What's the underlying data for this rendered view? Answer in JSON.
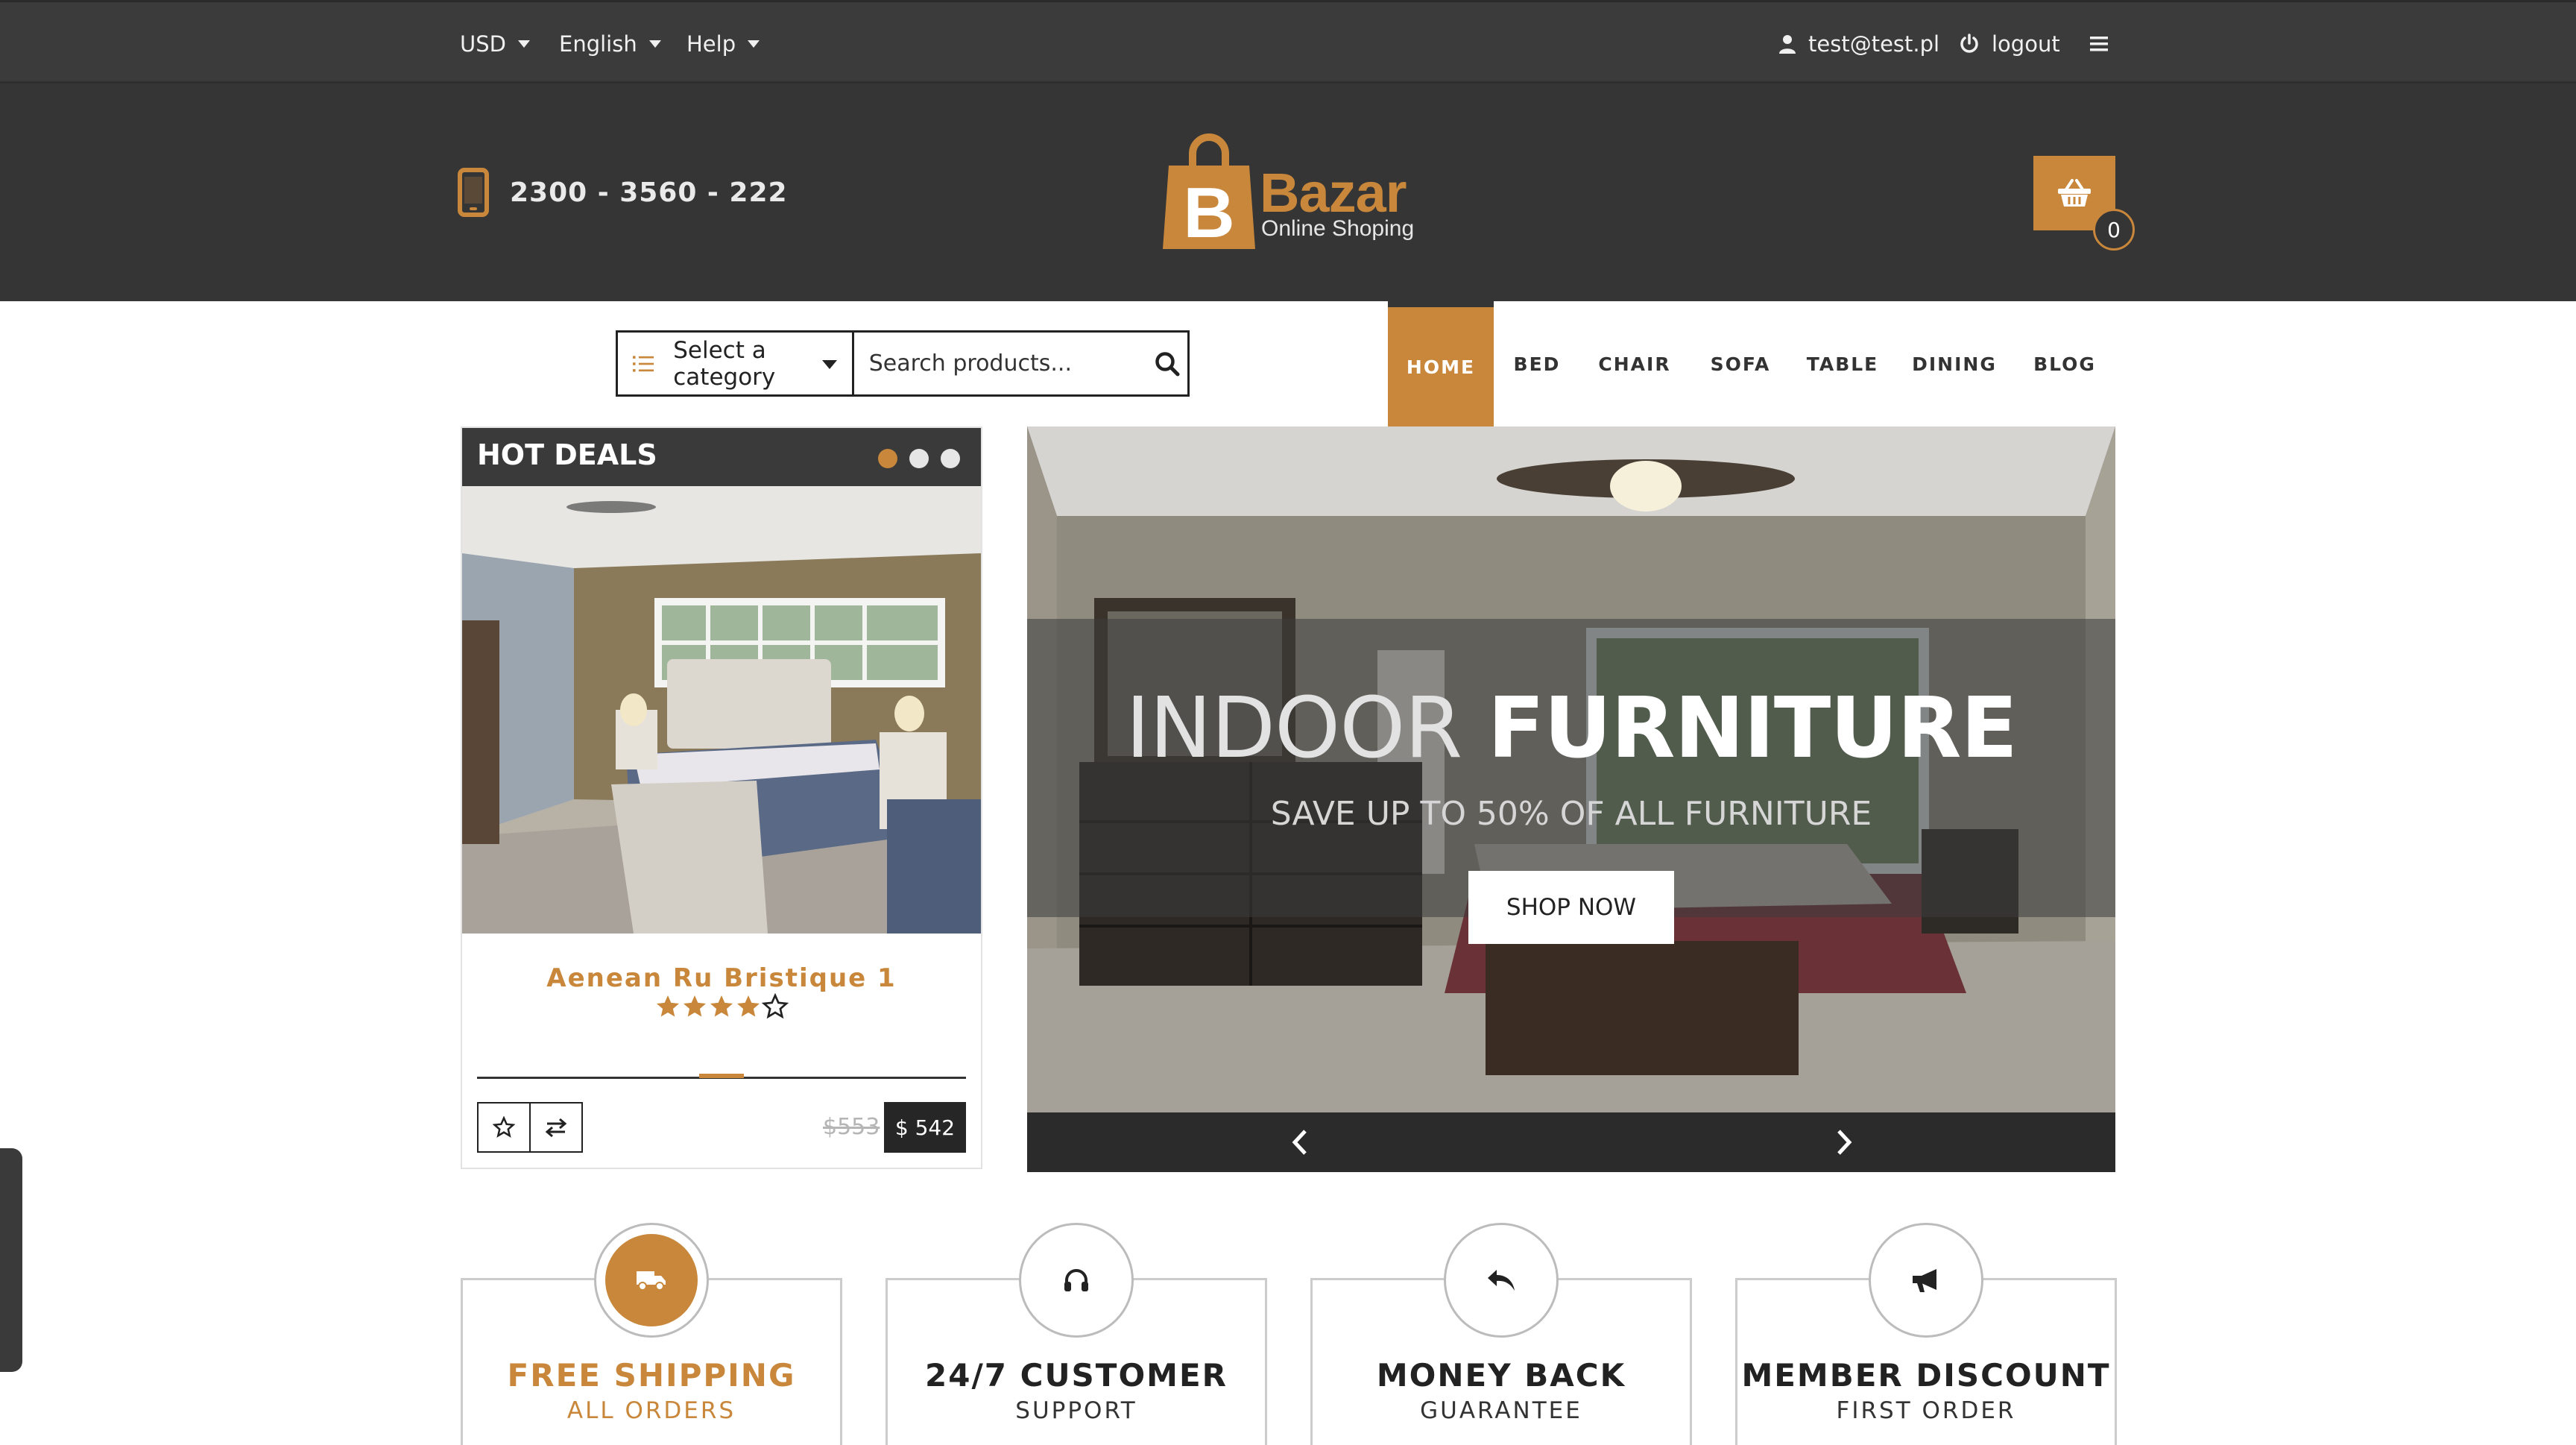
{
  "topbar": {
    "currency": "USD",
    "language": "English",
    "help": "Help",
    "user_email": "test@test.pl",
    "logout": "logout"
  },
  "header": {
    "phone": "2300 - 3560 - 222",
    "logo_letter": "B",
    "logo_name": "Bazar",
    "logo_tagline": "Online Shoping",
    "cart_count": "0"
  },
  "search": {
    "category_label": "Select a category",
    "placeholder": "Search products..."
  },
  "nav": {
    "items": [
      {
        "label": "HOME",
        "active": true
      },
      {
        "label": "BED"
      },
      {
        "label": "CHAIR"
      },
      {
        "label": "SOFA"
      },
      {
        "label": "TABLE"
      },
      {
        "label": "DINING"
      },
      {
        "label": "BLOG"
      }
    ]
  },
  "hot_deals": {
    "title": "HOT DEALS",
    "product_name": "Aenean Ru Bristique 1",
    "rating_stars": 4,
    "rating_max": 5,
    "old_price": "$553",
    "price": "$ 542"
  },
  "hero": {
    "title_light": "INDOOR ",
    "title_bold": "FURNITURE",
    "subtitle": "SAVE UP TO 50% OF ALL FURNITURE",
    "button": "SHOP NOW"
  },
  "features": [
    {
      "title": "FREE SHIPPING",
      "subtitle": "ALL ORDERS",
      "icon": "truck-icon"
    },
    {
      "title": "24/7 CUSTOMER",
      "subtitle": "SUPPORT",
      "icon": "headphones-icon"
    },
    {
      "title": "MONEY BACK",
      "subtitle": "GUARANTEE",
      "icon": "reply-icon"
    },
    {
      "title": "MEMBER DISCOUNT",
      "subtitle": "FIRST ORDER",
      "icon": "megaphone-icon"
    }
  ],
  "colors": {
    "accent": "#c8873a",
    "dark": "#353535",
    "topbar": "#3b3b3b"
  }
}
